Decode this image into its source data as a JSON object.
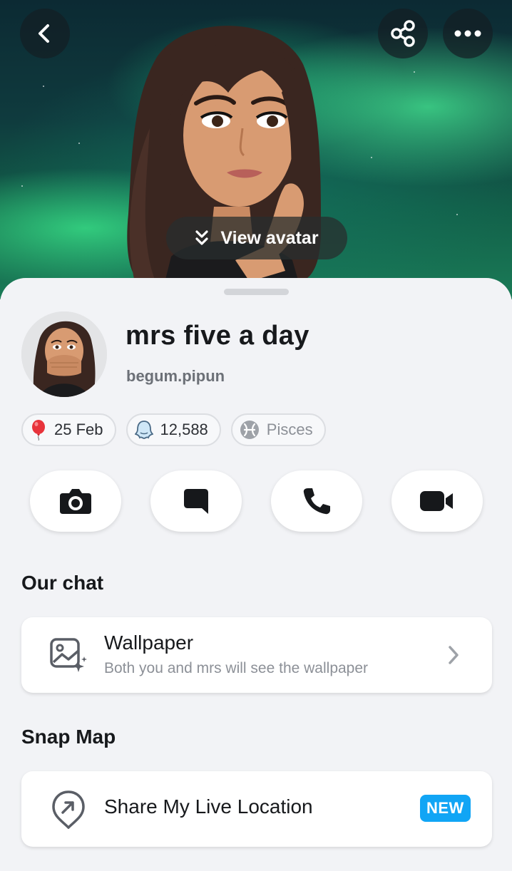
{
  "header": {
    "back_icon": "chevron-left-icon",
    "share_icon": "share-icon",
    "more_icon": "more-dots-icon",
    "view_avatar_label": "View avatar",
    "view_avatar_icon": "double-chevron-down-icon"
  },
  "profile": {
    "display_name": "mrs five a day",
    "username": "begum.pipun"
  },
  "chips": [
    {
      "icon": "balloon-icon",
      "label": "25 Feb"
    },
    {
      "icon": "ghost-icon",
      "label": "12,588"
    },
    {
      "icon": "pisces-icon",
      "label": "Pisces"
    }
  ],
  "actions": [
    {
      "icon": "camera-icon",
      "name": "camera"
    },
    {
      "icon": "chat-icon",
      "name": "chat"
    },
    {
      "icon": "phone-icon",
      "name": "call"
    },
    {
      "icon": "video-icon",
      "name": "video-call"
    }
  ],
  "our_chat": {
    "title": "Our chat",
    "wallpaper": {
      "icon": "wallpaper-icon",
      "title": "Wallpaper",
      "subtitle": "Both you and mrs will see the wallpaper"
    }
  },
  "snap_map": {
    "title": "Snap Map",
    "share_location": {
      "icon": "location-share-icon",
      "title": "Share My Live Location",
      "badge": "NEW"
    }
  },
  "colors": {
    "badge": "#11a5f5",
    "accent_green": "#3ceb8c"
  }
}
